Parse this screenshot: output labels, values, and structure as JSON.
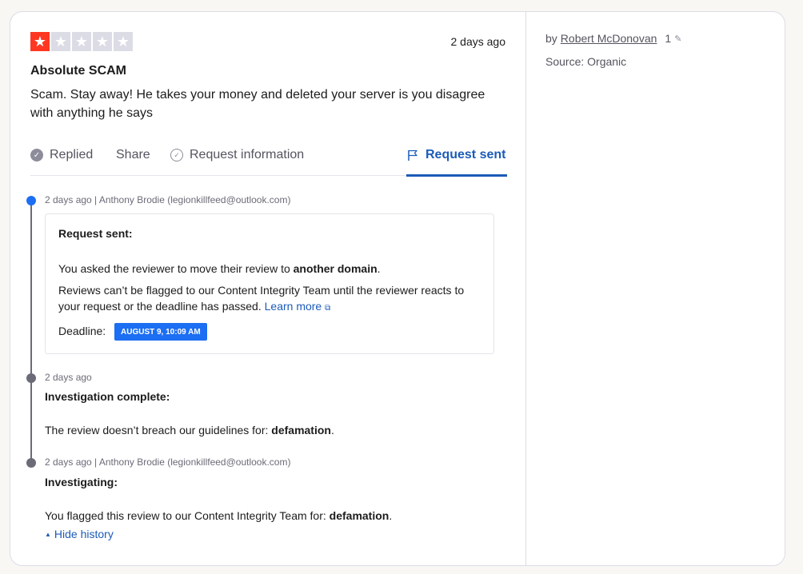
{
  "review": {
    "rating": 1,
    "max_rating": 5,
    "date": "2 days ago",
    "title": "Absolute SCAM",
    "body": "Scam. Stay away! He takes your money and deleted your server is you disagree with anything he says"
  },
  "actions": {
    "replied": "Replied",
    "share": "Share",
    "request_information": "Request information",
    "request_sent": "Request sent"
  },
  "timeline": {
    "entry1": {
      "meta": "2 days ago | Anthony Brodie (legionkillfeed@outlook.com)",
      "title": "Request sent:",
      "line1_prefix": "You asked the reviewer to move their review to ",
      "line1_bold": "another domain",
      "line1_suffix": ".",
      "line2": "Reviews can’t be flagged to our Content Integrity Team until the reviewer reacts to your request or the deadline has passed.",
      "learn_more": "Learn more",
      "deadline_label": "Deadline:",
      "deadline_value": "AUGUST 9, 10:09 AM"
    },
    "entry2": {
      "meta": "2 days ago",
      "title": "Investigation complete:",
      "text_prefix": "The review doesn’t breach our guidelines for: ",
      "text_bold": "defamation",
      "text_suffix": "."
    },
    "entry3": {
      "meta": "2 days ago | Anthony Brodie (legionkillfeed@outlook.com)",
      "title": "Investigating:",
      "text_prefix": "You flagged this review to our Content Integrity Team for: ",
      "text_bold": "defamation",
      "text_suffix": "."
    },
    "hide_history": "Hide history"
  },
  "sidebar": {
    "by_prefix": "by",
    "author": "Robert McDonovan",
    "review_count": "1",
    "source": "Source: Organic"
  },
  "colors": {
    "star_filled": "#ff3722",
    "star_empty": "#dcdce6",
    "accent_blue": "#1c5bb8",
    "badge_blue": "#1c6ef2"
  },
  "icons": {
    "star": "star-icon",
    "replied": "check-circle-icon",
    "request_information": "check-circle-outline-icon",
    "request_sent": "flag-icon",
    "external": "external-link-icon",
    "pencil": "pencil-icon",
    "triangle": "triangle-up-icon"
  }
}
